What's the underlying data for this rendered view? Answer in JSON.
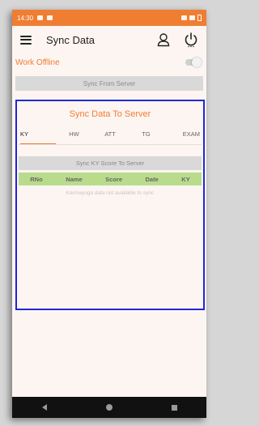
{
  "status_bar": {
    "time": "14:30"
  },
  "app_bar": {
    "title": "Sync Data",
    "menu_icon": "hamburger-icon",
    "user_icon": "user-icon",
    "power_icon": "power-icon"
  },
  "offline": {
    "label": "Work Offline",
    "enabled": false
  },
  "sync_from_server": {
    "label": "Sync From Server"
  },
  "sync_to_server": {
    "title": "Sync Data To Server",
    "tabs": [
      {
        "label": "KY",
        "active": true
      },
      {
        "label": "HW"
      },
      {
        "label": "ATT"
      },
      {
        "label": "TG"
      },
      {
        "label": "EXAM"
      }
    ],
    "sync_button": "Sync KY Score To Server",
    "columns": [
      "RNo",
      "Name",
      "Score",
      "Date",
      "KY"
    ],
    "empty_message": "Karmayoga data not available to sync"
  },
  "colors": {
    "accent": "#ef7d32",
    "table_header": "#b9dc8c",
    "highlight_border": "#1f27d8"
  }
}
